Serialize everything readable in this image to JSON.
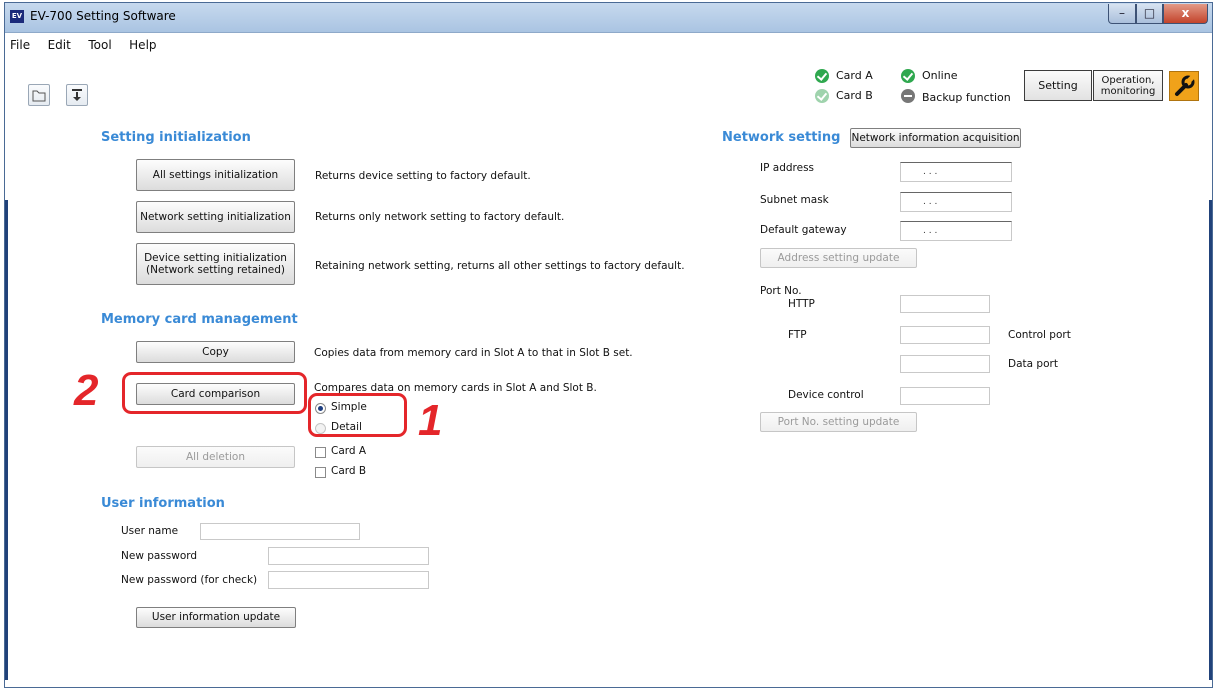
{
  "window": {
    "title": "EV-700 Setting Software",
    "icon_text": "EV",
    "controls": {
      "minimize": "–",
      "maximize": "□",
      "close": "x"
    }
  },
  "menu": [
    "File",
    "Edit",
    "Tool",
    "Help"
  ],
  "toolbar": {
    "icons": [
      "folder-open-icon",
      "download-icon"
    ]
  },
  "status": {
    "card_a": "Card A",
    "card_b": "Card B",
    "online": "Online",
    "backup": "Backup function"
  },
  "mode": {
    "setting": "Setting",
    "operation_line1": "Operation,",
    "operation_line2": "monitoring"
  },
  "setting_initialization": {
    "title": "Setting initialization",
    "all_btn": "All settings initialization",
    "all_desc": "Returns device setting to factory default.",
    "network_btn": "Network setting initialization",
    "network_desc": "Returns only network setting to factory default.",
    "device_btn_line1": "Device setting initialization",
    "device_btn_line2": "(Network setting retained)",
    "device_desc": "Retaining network setting, returns all other settings to factory default."
  },
  "memory_card": {
    "title": "Memory card management",
    "copy_btn": "Copy",
    "copy_desc": "Copies data from memory card in Slot A to that in Slot B set.",
    "compare_btn": "Card comparison",
    "compare_desc": "Compares data on memory cards in Slot A and Slot B.",
    "simple_label": "Simple",
    "detail_label": "Detail",
    "delete_btn": "All deletion",
    "card_a_label": "Card A",
    "card_b_label": "Card B"
  },
  "user_info": {
    "title": "User information",
    "user_name_label": "User name",
    "new_password_label": "New password",
    "confirm_password_label": "New password (for check)",
    "update_btn": "User information update",
    "user_name_value": "",
    "new_password_value": "",
    "confirm_password_value": ""
  },
  "network": {
    "title": "Network setting",
    "acquire_btn": "Network information acquisition",
    "ip_label": "IP address",
    "subnet_label": "Subnet mask",
    "gateway_label": "Default gateway",
    "ip_value": ".   .   .",
    "subnet_value": ".   .   .",
    "gateway_value": ".   .   .",
    "address_update_btn": "Address setting update",
    "port_no_label": "Port No.",
    "http_label": "HTTP",
    "ftp_label": "FTP",
    "control_port_label": "Control port",
    "data_port_label": "Data port",
    "device_control_label": "Device control",
    "port_update_btn": "Port No. setting update"
  },
  "annotations": {
    "callout_1": "1",
    "callout_2": "2",
    "color": "#e4262a"
  },
  "colors": {
    "section_title": "#3a8ad6",
    "title_bar": "#aac4e2",
    "status_green": "#2fa84f"
  }
}
